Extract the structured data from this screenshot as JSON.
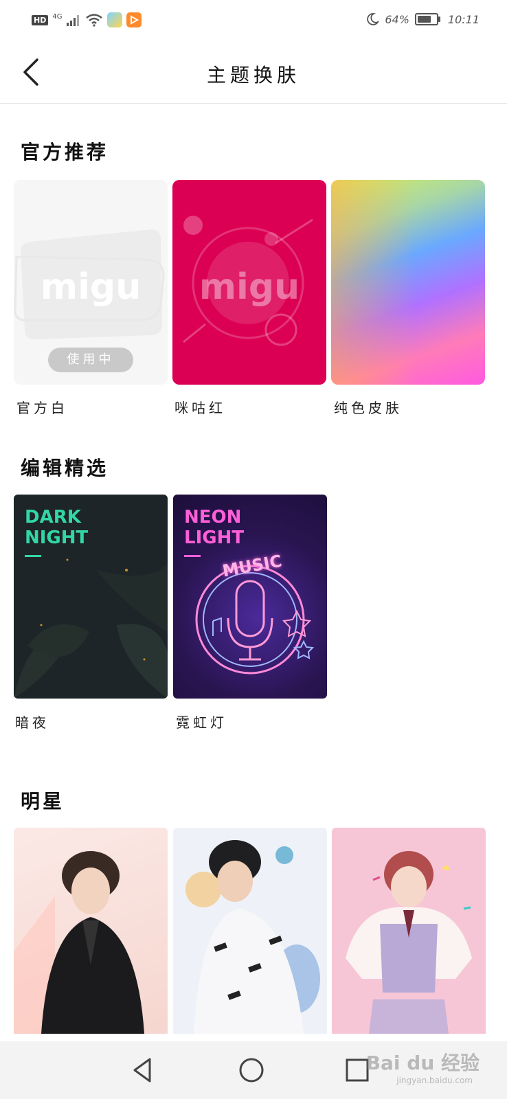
{
  "status_bar": {
    "hd_badge": "HD",
    "network": "4G",
    "battery_percent": "64%",
    "battery_level": 0.64,
    "time": "10:11"
  },
  "header": {
    "title": "主题换肤"
  },
  "sections": [
    {
      "title": "官方推荐",
      "items": [
        {
          "label": "官方白",
          "logo_text": "migu",
          "badge": "使用中"
        },
        {
          "label": "咪咕红",
          "logo_text": "migu"
        },
        {
          "label": "纯色皮肤"
        }
      ]
    },
    {
      "title": "编辑精选",
      "items": [
        {
          "label": "暗夜",
          "overlay_title": "DARK NIGHT",
          "accent": "#33d6a5"
        },
        {
          "label": "霓虹灯",
          "overlay_title": "NEON LIGHT",
          "sign_text": "MUSIC",
          "accent": "#ff5fd8"
        }
      ]
    },
    {
      "title": "明星",
      "items": [
        {
          "image": "star-photo-1"
        },
        {
          "image": "star-photo-2"
        },
        {
          "image": "star-photo-3"
        }
      ]
    }
  ],
  "colors": {
    "migu_red": "#dc0055",
    "official_white": "#f6f6f6",
    "dark_night_bg": "#1d2528",
    "neon_bg": "#2a1552"
  },
  "icons": [
    "back-icon",
    "moon-icon",
    "wifi-icon",
    "signal-icon",
    "nav-back-icon",
    "nav-home-icon",
    "nav-recent-icon"
  ],
  "watermark": {
    "text": "Bai du 经验",
    "sub": "jingyan.baidu.com"
  }
}
